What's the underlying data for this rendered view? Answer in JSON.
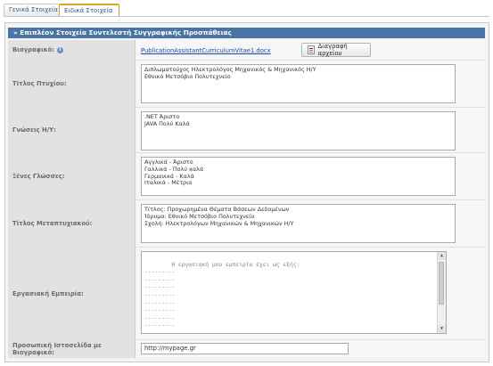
{
  "tabs": [
    {
      "label": "Γενικά Στοιχεία",
      "active": false
    },
    {
      "label": "Ειδικά Στοιχεία",
      "active": true
    }
  ],
  "header": "» Επιπλέον Στοιχεία Συντελεστή Συγγραφικής Προσπάθειας",
  "cv": {
    "label": "Βιογραφικό:",
    "info_icon": "info-icon",
    "file_link": "PublicationAssistantCurriculumVitae1.docx",
    "delete_button": "Διαγραφή αρχείου"
  },
  "degree": {
    "label": "Τίτλος Πτυχίου:",
    "value": "Διπλωματούχος Ηλεκτρολόγος Μηχανικός & Μηχανικός Η/Υ\nΕθνικό Μετσόβιο Πολυτεχνείο"
  },
  "it_skills": {
    "label": "Γνώσεις Η/Υ:",
    "value": ".NET Άριστο\nJAVA Πολύ Καλά"
  },
  "languages": {
    "label": "Ξένες Γλώσσες:",
    "value": "Αγγλικά - Άριστο\nΓαλλικά - Πολύ καλά\nΓερμανικά - Καλά\nΙταλικά - Μέτρια"
  },
  "postgrad": {
    "label": "Τίτλος Μεταπτυχιακού:",
    "value": "Τίτλος: Προχωρημένα Θέματα Βάσεων Δεδομένων\nΊδρυμα: Εθνικό Μετσόβιο Πολυτεχνείο\nΣχολή: Ηλεκτρολόγων Μηχανικών & Μηχανικών Η/Υ"
  },
  "experience": {
    "label": "Εργασιακή Εμπειρία:",
    "value": "Η εργασιακή μου εμπειρία έχει ως εξής:\n---------\n---------\n---------\n---------\n---------\n---------\n---------\n---------\n---------\n---------"
  },
  "homepage": {
    "label": "Προσωπική Ιστοσελίδα με Βιογραφικό:",
    "value": "http://mypage.gr"
  }
}
